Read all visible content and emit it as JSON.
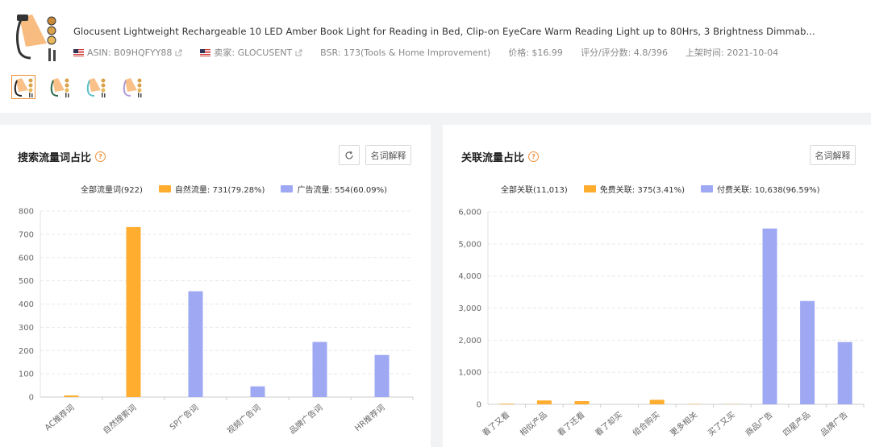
{
  "product": {
    "title": "Glocusent Lightweight Rechargeable 10 LED Amber Book Light for Reading in Bed, Clip-on EyeCare Warm Reading Light up to 80Hrs, 3 Brightness Dimmab...",
    "asin_label": "ASIN: B09HQFYY88",
    "seller_label": "卖家: GLOCUSENT",
    "bsr_label": "BSR: 173(Tools & Home Improvement)",
    "price_label": "价格: $16.99",
    "rating_label": "评分/评分数: 4.8/396",
    "date_label": "上架时间: 2021-10-04",
    "variant_colors": [
      "#222222",
      "#2a6b4e",
      "#5fc0c8",
      "#b09ad8"
    ]
  },
  "left_panel": {
    "title": "搜索流量词占比",
    "refresh_icon": "refresh-icon",
    "explain_label": "名词解释",
    "legend": {
      "all": "全部流量词(922)",
      "organic": "自然流量: 731(79.28%)",
      "ad": "广告流量: 554(60.09%)"
    }
  },
  "right_panel": {
    "title": "关联流量占比",
    "explain_label": "名词解释",
    "legend": {
      "all": "全部关联(11,013)",
      "free": "免费关联: 375(3.41%)",
      "paid": "付费关联: 10,638(96.59%)"
    }
  },
  "colors": {
    "orange": "#ffad2f",
    "blue": "#9fa8f3",
    "accent": "#f0903a"
  },
  "chart_data": [
    {
      "type": "bar",
      "title": "搜索流量词占比",
      "categories": [
        "AC推荐词",
        "自然搜索词",
        "SP广告词",
        "视频广告词",
        "品牌广告词",
        "HR推荐词"
      ],
      "values": [
        7,
        731,
        455,
        46,
        237,
        181
      ],
      "bar_colors": [
        "orange",
        "orange",
        "blue",
        "blue",
        "blue",
        "blue"
      ],
      "ylim": [
        0,
        800
      ],
      "yticks": [
        0,
        100,
        200,
        300,
        400,
        500,
        600,
        700,
        800
      ],
      "ytick_labels": [
        "0",
        "100",
        "200",
        "300",
        "400",
        "500",
        "600",
        "700",
        "800"
      ],
      "grid": true
    },
    {
      "type": "bar",
      "title": "关联流量占比",
      "categories": [
        "看了又看",
        "相似产品",
        "看了还看",
        "看了却买",
        "组合购买",
        "更多相关",
        "买了又买",
        "商品广告",
        "四星产品",
        "品牌广告"
      ],
      "values": [
        20,
        120,
        100,
        0,
        140,
        10,
        5,
        5480,
        3220,
        1940
      ],
      "bar_colors": [
        "orange",
        "orange",
        "orange",
        "orange",
        "orange",
        "orange",
        "orange",
        "blue",
        "blue",
        "blue"
      ],
      "ylim": [
        0,
        6000
      ],
      "yticks": [
        0,
        1000,
        2000,
        3000,
        4000,
        5000,
        6000
      ],
      "ytick_labels": [
        "0",
        "1,000",
        "2,000",
        "3,000",
        "4,000",
        "5,000",
        "6,000"
      ],
      "grid": true
    }
  ]
}
